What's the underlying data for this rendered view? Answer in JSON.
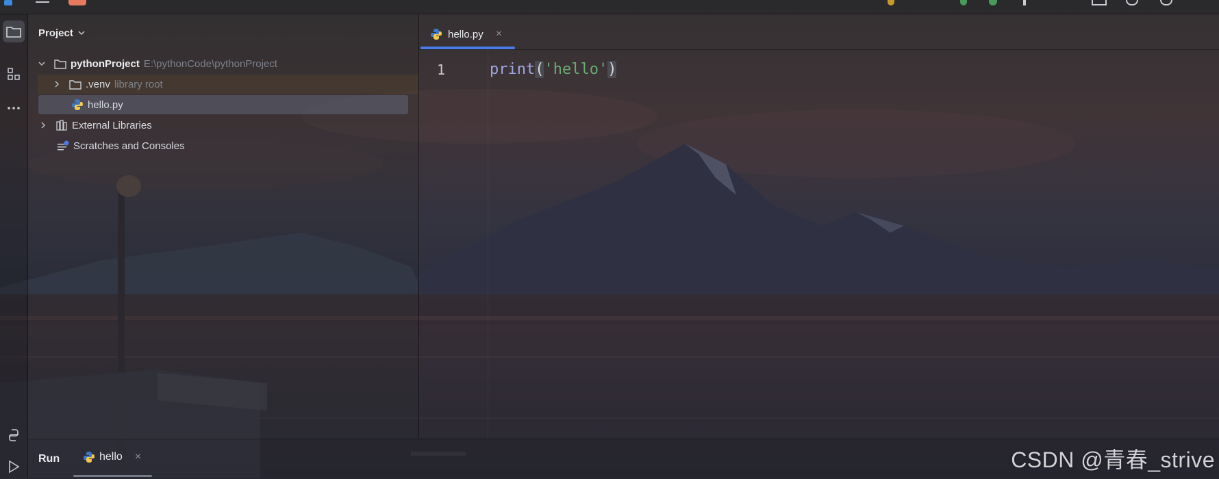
{
  "project_panel": {
    "title": "Project",
    "tree": {
      "root": {
        "name": "pythonProject",
        "path": "E:\\pythonCode\\pythonProject"
      },
      "venv": {
        "name": ".venv",
        "note": "library root"
      },
      "file": {
        "name": "hello.py"
      },
      "external": {
        "name": "External Libraries"
      },
      "scratches": {
        "name": "Scratches and Consoles"
      }
    }
  },
  "editor": {
    "tab": {
      "label": "hello.py",
      "close": "×"
    },
    "lines": [
      {
        "number": "1",
        "func": "print",
        "open": "(",
        "string": "'hello'",
        "close": ")"
      }
    ]
  },
  "run_panel": {
    "title": "Run",
    "tab": {
      "label": "hello",
      "close": "×"
    }
  },
  "watermark": "CSDN @青春_strive",
  "colors": {
    "accent": "#4b7be8",
    "keyword": "#9fa7e3",
    "string": "#6aab73",
    "muted": "#7d828c"
  },
  "icons": {
    "folder": "folder-icon",
    "python": "python-file-icon",
    "library": "library-icon",
    "scratches": "scratches-icon",
    "structure": "structure-icon",
    "more": "more-icon",
    "run": "run-icon",
    "python_console": "python-console-icon"
  }
}
